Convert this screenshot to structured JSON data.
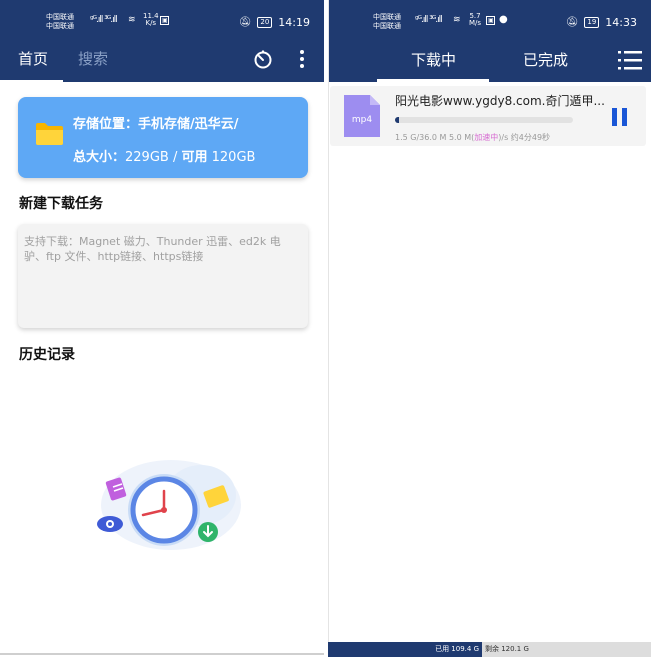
{
  "left": {
    "status": {
      "carrier1": "中国联通",
      "carrier2": "中国联通",
      "net": "4G",
      "speed": "11.4",
      "speed_unit": "K/s",
      "battery": "20",
      "time": "14:19"
    },
    "tabs": [
      "首页",
      "搜索"
    ],
    "storage": {
      "location_label": "存储位置：",
      "location_value": "手机存储/迅华云/",
      "total_label": "总大小：",
      "total_value": "229GB",
      "sep": " / ",
      "available_label": "可用",
      "available_value": " 120GB"
    },
    "new_task_title": "新建下载任务",
    "input_placeholder": "支持下载：Magnet 磁力、Thunder 迅雷、ed2k 电驴、ftp 文件、http链接、https链接",
    "history_title": "历史记录",
    "icons": [
      "timer-icon",
      "more-vertical-icon",
      "folder-icon"
    ]
  },
  "right": {
    "status": {
      "carrier1": "中国联通",
      "carrier2": "中国联通",
      "net": "4G",
      "speed": "5.7",
      "speed_unit": "M/s",
      "battery": "19",
      "time": "14:33"
    },
    "tabs": [
      "下载中",
      "已完成"
    ],
    "download": {
      "file_type": "mp4",
      "title": "阳光电影www.ygdy8.com.奇门遁甲...",
      "progress": 0.02,
      "meta_size": "1.5 G/36.0 M 5.0 M(",
      "meta_accel": "加速中",
      "meta_rest": ")/s 约4分49秒"
    },
    "storage_bar": {
      "used": "已用 109.4 G",
      "free": "剩余 120.1 G"
    },
    "icons": [
      "list-menu-icon",
      "pause-icon",
      "mp4-file-icon"
    ]
  },
  "colors": {
    "navy": "#1f3a70",
    "card_blue": "#5ea8f5",
    "folder_yellow": "#ffd43a",
    "accel_pink": "#d66bd1"
  }
}
